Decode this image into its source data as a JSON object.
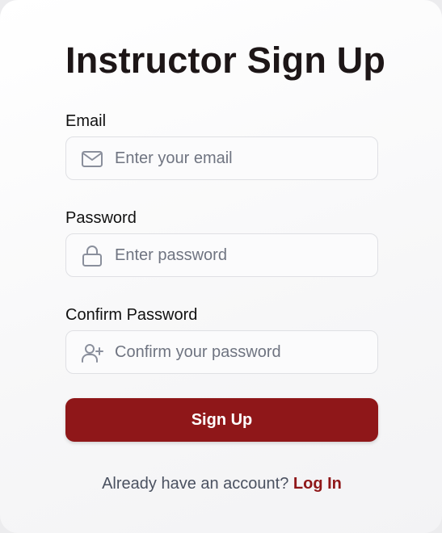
{
  "page": {
    "title": "Instructor Sign Up"
  },
  "form": {
    "email": {
      "label": "Email",
      "placeholder": "Enter your email",
      "value": "",
      "icon": "mail-icon"
    },
    "password": {
      "label": "Password",
      "placeholder": "Enter password",
      "value": "",
      "icon": "lock-icon"
    },
    "confirm_password": {
      "label": "Confirm Password",
      "placeholder": "Confirm your password",
      "value": "",
      "icon": "user-plus-icon"
    },
    "submit_label": "Sign Up"
  },
  "footer": {
    "prompt": "Already have an account?",
    "link_label": "Log In"
  },
  "colors": {
    "accent": "#8f1719",
    "title_text": "#1d1617",
    "icon": "#8a8f9c",
    "placeholder": "#6f7481"
  }
}
